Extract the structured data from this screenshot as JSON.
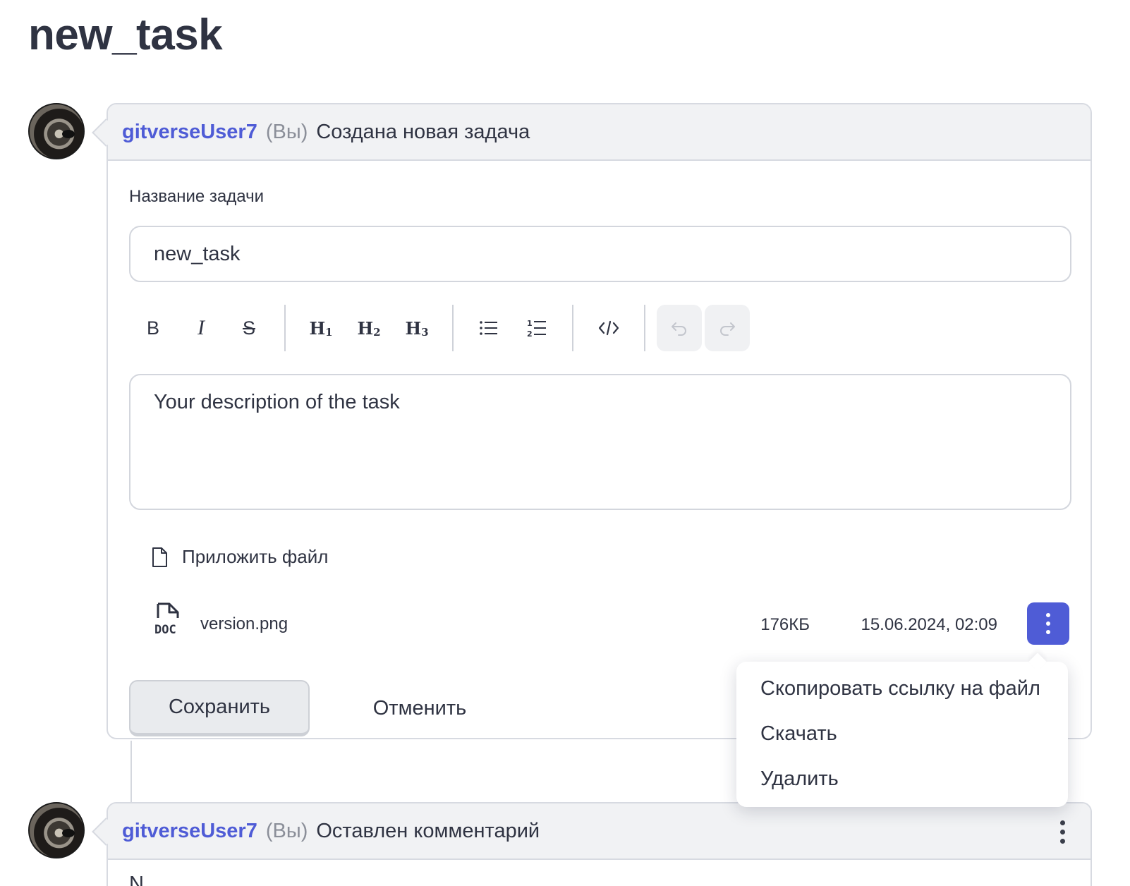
{
  "page": {
    "title": "new_task"
  },
  "event1": {
    "username": "gitverseUser7",
    "you_label": "(Вы)",
    "action": "Создана новая задача"
  },
  "form": {
    "title_label": "Название задачи",
    "title_value": "new_task",
    "description_value": "Your description of the task",
    "attach_label": "Приложить файл",
    "save_label": "Сохранить",
    "cancel_label": "Отменить"
  },
  "toolbar": {
    "bold": "B",
    "italic": "I",
    "strike": "S",
    "h1": "H",
    "h1_sub": "1",
    "h2": "H",
    "h2_sub": "2",
    "h3": "H",
    "h3_sub": "3",
    "icons": [
      "bold-icon",
      "italic-icon",
      "strikethrough-icon",
      "heading-1-icon",
      "heading-2-icon",
      "heading-3-icon",
      "bullet-list-icon",
      "numbered-list-icon",
      "code-icon",
      "undo-icon",
      "redo-icon"
    ]
  },
  "attachment": {
    "file_name": "version.png",
    "size": "176КБ",
    "date": "15.06.2024, 02:09",
    "icon_label": "DOC"
  },
  "file_menu": {
    "items": [
      "Скопировать ссылку на файл",
      "Скачать",
      "Удалить"
    ]
  },
  "event2": {
    "username": "gitverseUser7",
    "you_label": "(Вы)",
    "action": "Оставлен комментарий",
    "body_preview": "N"
  },
  "colors": {
    "accent": "#4f5cd6",
    "header_bg": "#f1f2f4",
    "border": "#d7dae1",
    "text": "#2f3342"
  }
}
